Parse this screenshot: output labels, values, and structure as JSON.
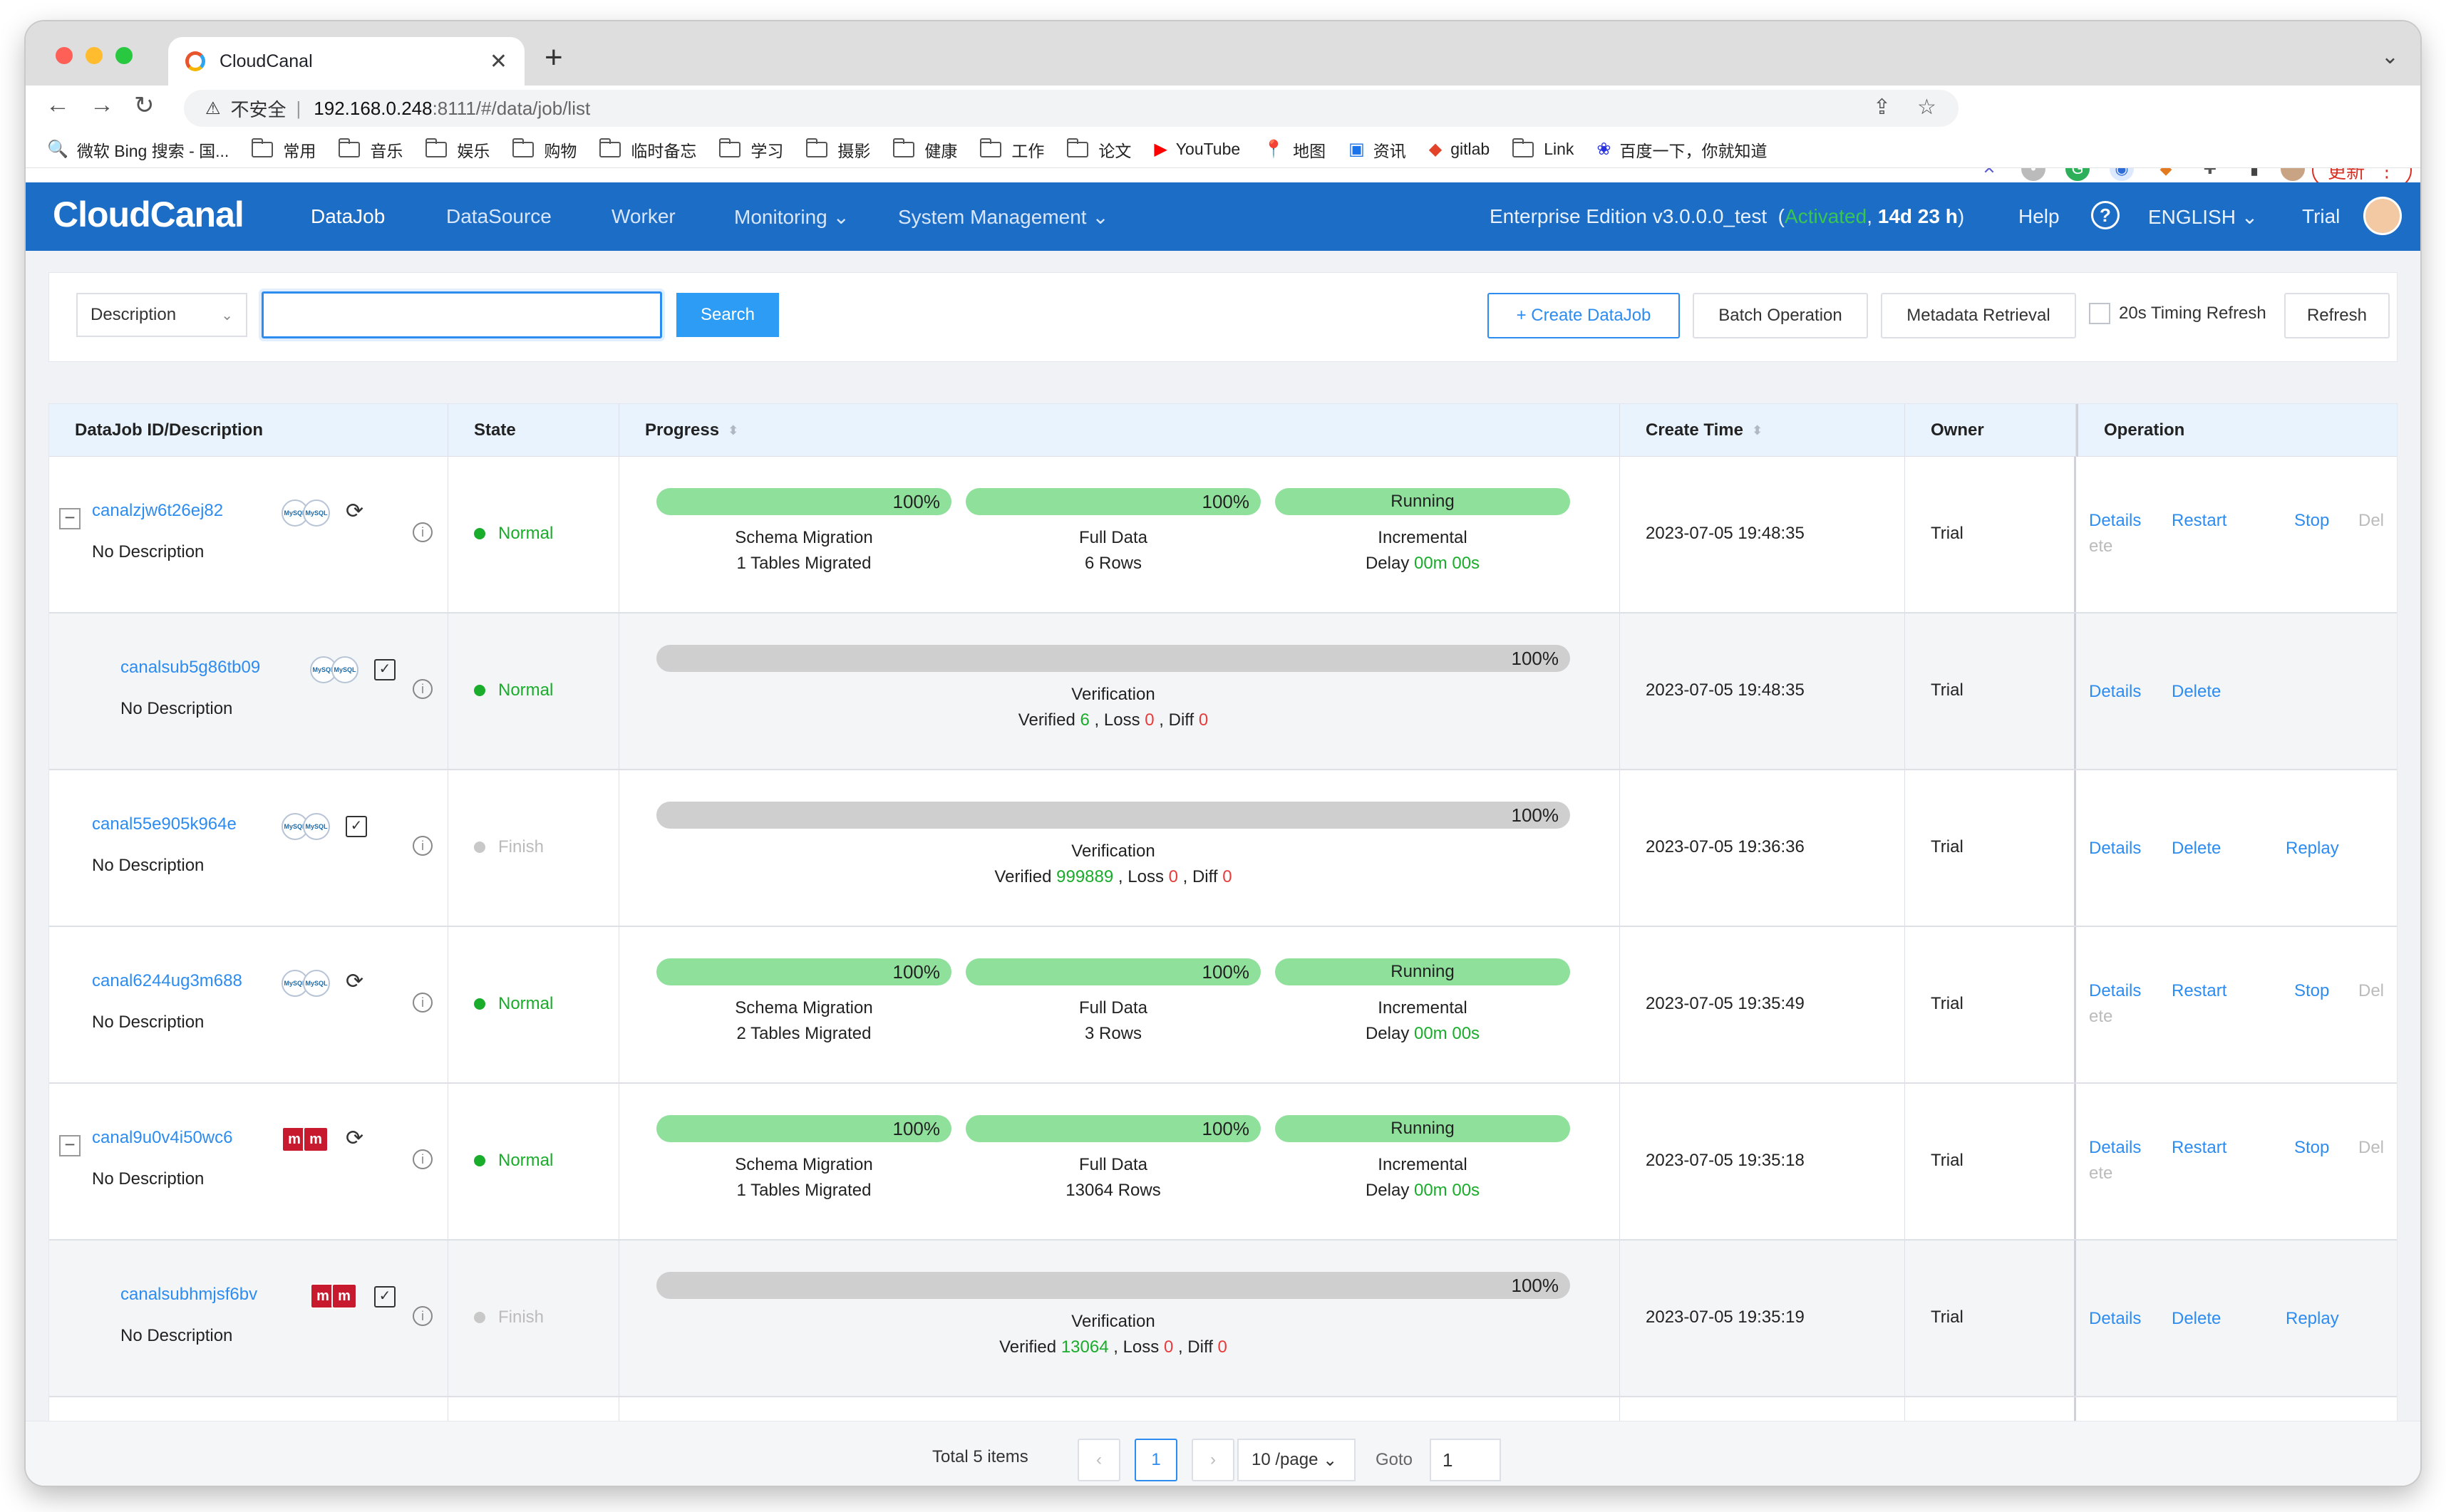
{
  "browser": {
    "tab_title": "CloudCanal",
    "url_warning": "不安全",
    "url_host": "192.168.0.248",
    "url_path": ":8111/#/data/job/list",
    "update_label": "更新"
  },
  "bookmarks": [
    "微软 Bing 搜索 - 国...",
    "常用",
    "音乐",
    "娱乐",
    "购物",
    "临时备忘",
    "学习",
    "摄影",
    "健康",
    "工作",
    "论文",
    "YouTube",
    "地图",
    "资讯",
    "gitlab",
    "Link",
    "百度一下，你就知道"
  ],
  "header": {
    "logo": "CloudCanal",
    "menu": [
      "DataJob",
      "DataSource",
      "Worker",
      "Monitoring",
      "System Management"
    ],
    "edition_prefix": "Enterprise Edition v3.0.0.0_test",
    "activated": "Activated",
    "days": "14d 23 h",
    "help": "Help",
    "language": "ENGLISH",
    "user": "Trial"
  },
  "search": {
    "field_select": "Description",
    "search_button": "Search",
    "create_button": "+ Create DataJob",
    "batch_button": "Batch Operation",
    "metadata_button": "Metadata Retrieval",
    "timing_label": "20s Timing Refresh",
    "refresh_button": "Refresh"
  },
  "table": {
    "columns": [
      "DataJob ID/Description",
      "State",
      "Progress",
      "Create Time",
      "Owner",
      "Operation"
    ],
    "rows": [
      {
        "id": "canalzjw6t26ej82",
        "desc": "No Description",
        "state": "Normal",
        "type": "sync",
        "p1": "100%",
        "p2": "100%",
        "p3": "Running",
        "l1a": "Schema Migration",
        "l1b": "1 Tables Migrated",
        "l2a": "Full Data",
        "l2b": "6 Rows",
        "l3a": "Incremental",
        "l3b": "Delay",
        "delay": "00m 00s",
        "time": "2023-07-05 19:48:35",
        "owner": "Trial",
        "ops": [
          "Details",
          "Restart",
          "Stop",
          "Del",
          "ete"
        ]
      },
      {
        "id": "canalsub5g86tb09",
        "desc": "No Description",
        "state": "Normal",
        "type": "verify",
        "p1": "100%",
        "va": "Verification",
        "vb": "Verified",
        "verified": "6",
        "loss_label": ", Loss",
        "loss": "0",
        "diff_label": ", Diff",
        "diff": "0",
        "time": "2023-07-05 19:48:35",
        "owner": "Trial",
        "ops": [
          "Details",
          "Delete"
        ]
      },
      {
        "id": "canal55e905k964e",
        "desc": "No Description",
        "state": "Finish",
        "type": "verify",
        "p1": "100%",
        "va": "Verification",
        "vb": "Verified",
        "verified": "999889",
        "loss_label": ", Loss",
        "loss": "0",
        "diff_label": ", Diff",
        "diff": "0",
        "time": "2023-07-05 19:36:36",
        "owner": "Trial",
        "ops": [
          "Details",
          "Delete",
          "Replay"
        ]
      },
      {
        "id": "canal6244ug3m688",
        "desc": "No Description",
        "state": "Normal",
        "type": "sync",
        "p1": "100%",
        "p2": "100%",
        "p3": "Running",
        "l1a": "Schema Migration",
        "l1b": "2 Tables Migrated",
        "l2a": "Full Data",
        "l2b": "3 Rows",
        "l3a": "Incremental",
        "l3b": "Delay",
        "delay": "00m 00s",
        "time": "2023-07-05 19:35:49",
        "owner": "Trial",
        "ops": [
          "Details",
          "Restart",
          "Stop",
          "Del",
          "ete"
        ]
      },
      {
        "id": "canal9u0v4i50wc6",
        "desc": "No Description",
        "state": "Normal",
        "type": "sync",
        "p1": "100%",
        "p2": "100%",
        "p3": "Running",
        "l1a": "Schema Migration",
        "l1b": "1 Tables Migrated",
        "l2a": "Full Data",
        "l2b": "13064 Rows",
        "l3a": "Incremental",
        "l3b": "Delay",
        "delay": "00m 00s",
        "time": "2023-07-05 19:35:18",
        "owner": "Trial",
        "ops": [
          "Details",
          "Restart",
          "Stop",
          "Del",
          "ete"
        ]
      },
      {
        "id": "canalsubhmjsf6bv",
        "desc": "No Description",
        "state": "Finish",
        "type": "verify",
        "p1": "100%",
        "va": "Verification",
        "vb": "Verified",
        "verified": "13064",
        "loss_label": ", Loss",
        "loss": "0",
        "diff_label": ", Diff",
        "diff": "0",
        "time": "2023-07-05 19:35:19",
        "owner": "Trial",
        "ops": [
          "Details",
          "Delete",
          "Replay"
        ]
      }
    ]
  },
  "pagination": {
    "total": "Total 5 items",
    "current": "1",
    "page_size": "10 /page",
    "goto_label": "Goto",
    "goto_value": "1"
  },
  "colors": {
    "brand": "#1c6dc6",
    "link": "#2d8cf0",
    "success": "#1aac2b",
    "progress": "#8fe09b"
  }
}
